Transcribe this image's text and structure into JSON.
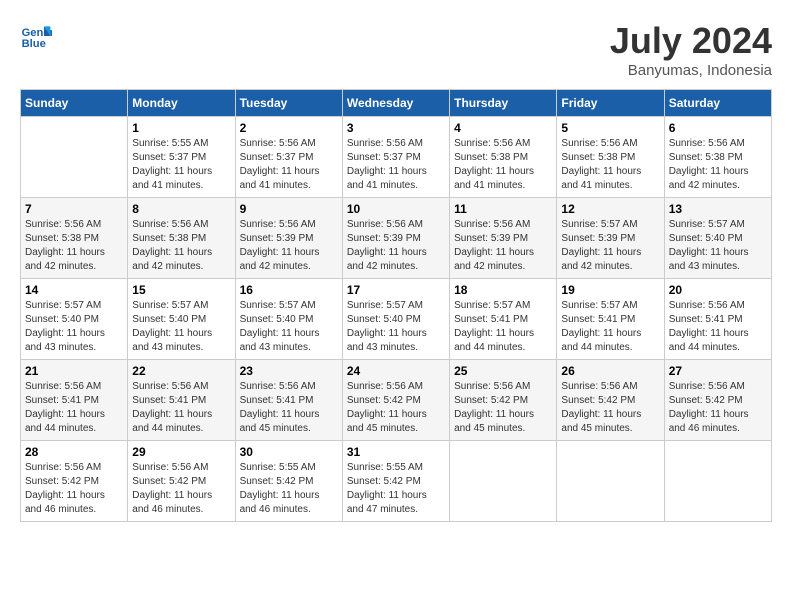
{
  "header": {
    "logo_line1": "General",
    "logo_line2": "Blue",
    "month_title": "July 2024",
    "location": "Banyumas, Indonesia"
  },
  "days_of_week": [
    "Sunday",
    "Monday",
    "Tuesday",
    "Wednesday",
    "Thursday",
    "Friday",
    "Saturday"
  ],
  "weeks": [
    [
      {
        "day": "",
        "info": ""
      },
      {
        "day": "1",
        "info": "Sunrise: 5:55 AM\nSunset: 5:37 PM\nDaylight: 11 hours and 41 minutes."
      },
      {
        "day": "2",
        "info": "Sunrise: 5:56 AM\nSunset: 5:37 PM\nDaylight: 11 hours and 41 minutes."
      },
      {
        "day": "3",
        "info": "Sunrise: 5:56 AM\nSunset: 5:37 PM\nDaylight: 11 hours and 41 minutes."
      },
      {
        "day": "4",
        "info": "Sunrise: 5:56 AM\nSunset: 5:38 PM\nDaylight: 11 hours and 41 minutes."
      },
      {
        "day": "5",
        "info": "Sunrise: 5:56 AM\nSunset: 5:38 PM\nDaylight: 11 hours and 41 minutes."
      },
      {
        "day": "6",
        "info": "Sunrise: 5:56 AM\nSunset: 5:38 PM\nDaylight: 11 hours and 42 minutes."
      }
    ],
    [
      {
        "day": "7",
        "info": "Sunrise: 5:56 AM\nSunset: 5:38 PM\nDaylight: 11 hours and 42 minutes."
      },
      {
        "day": "8",
        "info": "Sunrise: 5:56 AM\nSunset: 5:38 PM\nDaylight: 11 hours and 42 minutes."
      },
      {
        "day": "9",
        "info": "Sunrise: 5:56 AM\nSunset: 5:39 PM\nDaylight: 11 hours and 42 minutes."
      },
      {
        "day": "10",
        "info": "Sunrise: 5:56 AM\nSunset: 5:39 PM\nDaylight: 11 hours and 42 minutes."
      },
      {
        "day": "11",
        "info": "Sunrise: 5:56 AM\nSunset: 5:39 PM\nDaylight: 11 hours and 42 minutes."
      },
      {
        "day": "12",
        "info": "Sunrise: 5:57 AM\nSunset: 5:39 PM\nDaylight: 11 hours and 42 minutes."
      },
      {
        "day": "13",
        "info": "Sunrise: 5:57 AM\nSunset: 5:40 PM\nDaylight: 11 hours and 43 minutes."
      }
    ],
    [
      {
        "day": "14",
        "info": "Sunrise: 5:57 AM\nSunset: 5:40 PM\nDaylight: 11 hours and 43 minutes."
      },
      {
        "day": "15",
        "info": "Sunrise: 5:57 AM\nSunset: 5:40 PM\nDaylight: 11 hours and 43 minutes."
      },
      {
        "day": "16",
        "info": "Sunrise: 5:57 AM\nSunset: 5:40 PM\nDaylight: 11 hours and 43 minutes."
      },
      {
        "day": "17",
        "info": "Sunrise: 5:57 AM\nSunset: 5:40 PM\nDaylight: 11 hours and 43 minutes."
      },
      {
        "day": "18",
        "info": "Sunrise: 5:57 AM\nSunset: 5:41 PM\nDaylight: 11 hours and 44 minutes."
      },
      {
        "day": "19",
        "info": "Sunrise: 5:57 AM\nSunset: 5:41 PM\nDaylight: 11 hours and 44 minutes."
      },
      {
        "day": "20",
        "info": "Sunrise: 5:56 AM\nSunset: 5:41 PM\nDaylight: 11 hours and 44 minutes."
      }
    ],
    [
      {
        "day": "21",
        "info": "Sunrise: 5:56 AM\nSunset: 5:41 PM\nDaylight: 11 hours and 44 minutes."
      },
      {
        "day": "22",
        "info": "Sunrise: 5:56 AM\nSunset: 5:41 PM\nDaylight: 11 hours and 44 minutes."
      },
      {
        "day": "23",
        "info": "Sunrise: 5:56 AM\nSunset: 5:41 PM\nDaylight: 11 hours and 45 minutes."
      },
      {
        "day": "24",
        "info": "Sunrise: 5:56 AM\nSunset: 5:42 PM\nDaylight: 11 hours and 45 minutes."
      },
      {
        "day": "25",
        "info": "Sunrise: 5:56 AM\nSunset: 5:42 PM\nDaylight: 11 hours and 45 minutes."
      },
      {
        "day": "26",
        "info": "Sunrise: 5:56 AM\nSunset: 5:42 PM\nDaylight: 11 hours and 45 minutes."
      },
      {
        "day": "27",
        "info": "Sunrise: 5:56 AM\nSunset: 5:42 PM\nDaylight: 11 hours and 46 minutes."
      }
    ],
    [
      {
        "day": "28",
        "info": "Sunrise: 5:56 AM\nSunset: 5:42 PM\nDaylight: 11 hours and 46 minutes."
      },
      {
        "day": "29",
        "info": "Sunrise: 5:56 AM\nSunset: 5:42 PM\nDaylight: 11 hours and 46 minutes."
      },
      {
        "day": "30",
        "info": "Sunrise: 5:55 AM\nSunset: 5:42 PM\nDaylight: 11 hours and 46 minutes."
      },
      {
        "day": "31",
        "info": "Sunrise: 5:55 AM\nSunset: 5:42 PM\nDaylight: 11 hours and 47 minutes."
      },
      {
        "day": "",
        "info": ""
      },
      {
        "day": "",
        "info": ""
      },
      {
        "day": "",
        "info": ""
      }
    ]
  ]
}
